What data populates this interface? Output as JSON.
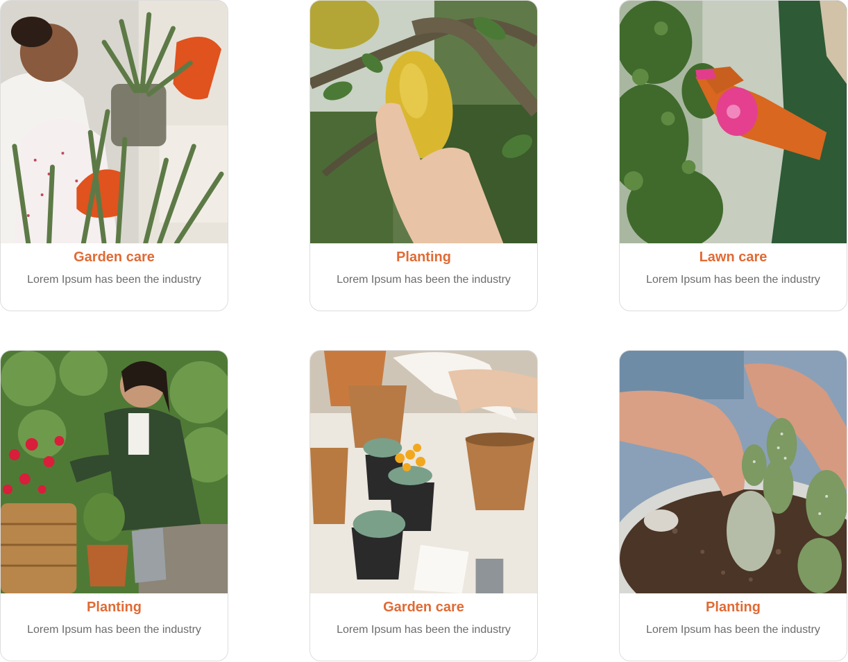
{
  "services": [
    {
      "title": "Garden care",
      "description": "Lorem Ipsum has been the industry",
      "photo": "woman-repotting-aloe-photo"
    },
    {
      "title": "Planting",
      "description": "Lorem Ipsum has been the industry",
      "photo": "hand-holding-lemon-photo"
    },
    {
      "title": "Lawn care",
      "description": "Lorem Ipsum has been the industry",
      "photo": "gloved-hands-spray-bottle-photo"
    },
    {
      "title": "Planting",
      "description": "Lorem Ipsum has been the industry",
      "photo": "woman-tending-roses-photo"
    },
    {
      "title": "Garden care",
      "description": "Lorem Ipsum has been the industry",
      "photo": "succulent-pots-table-photo"
    },
    {
      "title": "Planting",
      "description": "Lorem Ipsum has been the industry",
      "photo": "hands-planting-cactus-photo"
    }
  ],
  "colors": {
    "accent": "#e06a34",
    "text_muted": "#6b6b6b",
    "card_border": "#dcdcdc"
  }
}
